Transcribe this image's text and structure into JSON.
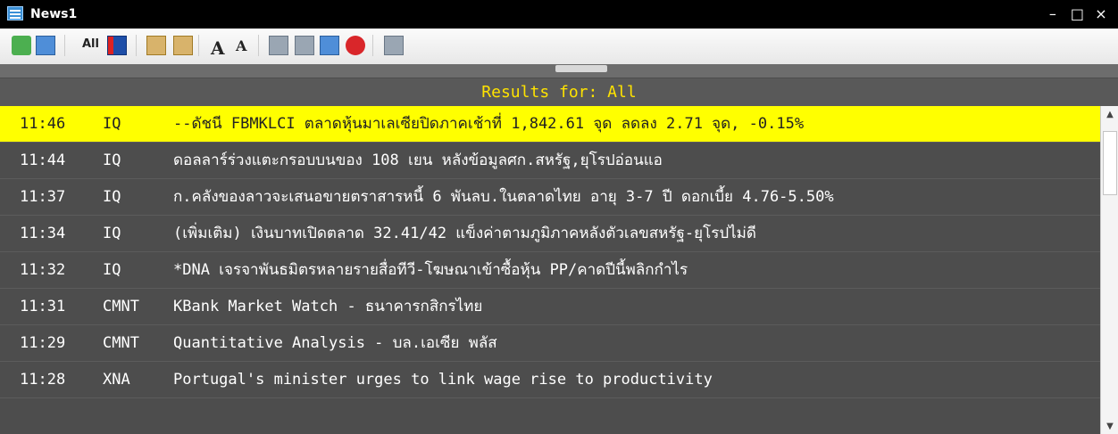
{
  "window": {
    "title": "News1",
    "controls": [
      "–",
      "□",
      "×"
    ]
  },
  "toolbar": {
    "all_label": "All",
    "font_a_large": "A",
    "font_a_small": "A"
  },
  "results_label": "Results for: All",
  "rows": [
    {
      "time": "11:46",
      "code": "IQ",
      "headline": "--ดัชนี FBMKLCI ตลาดหุ้นมาเลเซียปิดภาคเช้าที่ 1,842.61 จุด ลดลง 2.71 จุด, -0.15%"
    },
    {
      "time": "11:44",
      "code": "IQ",
      "headline": "ดอลลาร์ร่วงแตะกรอบบนของ 108 เยน หลังข้อมูลศก.สหรัฐ,ยุโรปอ่อนแอ"
    },
    {
      "time": "11:37",
      "code": "IQ",
      "headline": "ก.คลังของลาวจะเสนอขายตราสารหนี้ 6 พันลบ.ในตลาดไทย อายุ 3-7 ปี ดอกเบี้ย 4.76-5.50%"
    },
    {
      "time": "11:34",
      "code": "IQ",
      "headline": "(เพิ่มเติม) เงินบาทเปิดตลาด 32.41/42 แข็งค่าตามภูมิภาคหลังตัวเลขสหรัฐ-ยุโรปไม่ดี"
    },
    {
      "time": "11:32",
      "code": "IQ",
      "headline": "*DNA เจรจาพันธมิตรหลายรายสื่อทีวี-โฆษณาเข้าซื้อหุ้น PP/คาดปีนี้พลิกกำไร"
    },
    {
      "time": "11:31",
      "code": "CMNT",
      "headline": "KBank Market Watch - ธนาคารกสิกรไทย"
    },
    {
      "time": "11:29",
      "code": "CMNT",
      "headline": "Quantitative Analysis -  บล.เอเซีย พลัส"
    },
    {
      "time": "11:28",
      "code": "XNA",
      "headline": "Portugal's minister urges to link wage rise to productivity"
    }
  ]
}
